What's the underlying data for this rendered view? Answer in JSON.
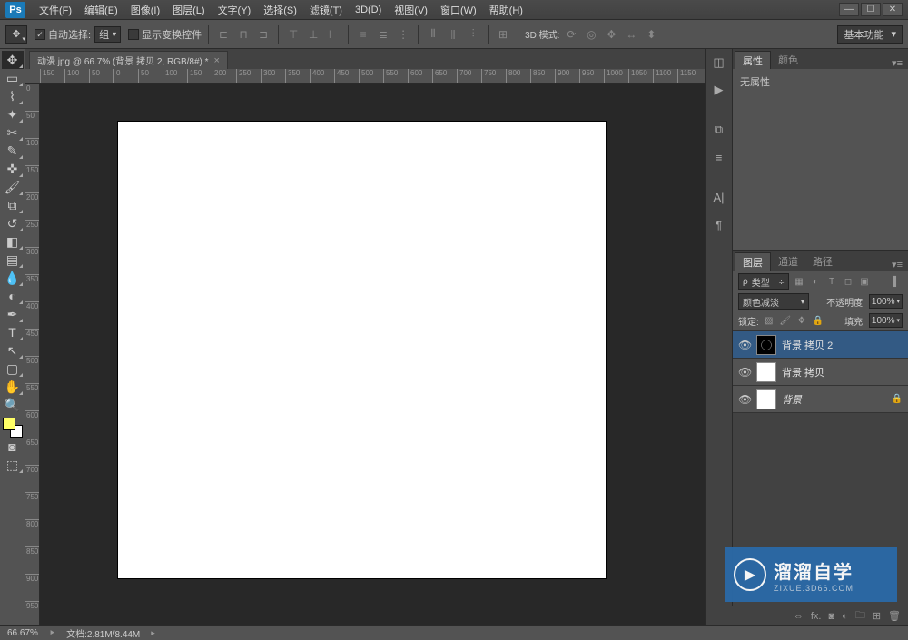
{
  "app": {
    "logo": "Ps"
  },
  "menu": {
    "file": "文件(F)",
    "edit": "编辑(E)",
    "image": "图像(I)",
    "layer": "图层(L)",
    "type": "文字(Y)",
    "select": "选择(S)",
    "filter": "滤镜(T)",
    "3d": "3D(D)",
    "view": "视图(V)",
    "window": "窗口(W)",
    "help": "帮助(H)"
  },
  "options": {
    "auto_select": "自动选择:",
    "group": "组",
    "show_transform": "显示变换控件",
    "mode_3d": "3D 模式:",
    "workspace": "基本功能"
  },
  "doc": {
    "tab_title": "动漫.jpg @ 66.7% (背景 拷贝 2, RGB/8#) *",
    "ruler_h": [
      "150",
      "100",
      "50",
      "0",
      "50",
      "100",
      "150",
      "200",
      "250",
      "300",
      "350",
      "400",
      "450",
      "500",
      "550",
      "600",
      "650",
      "700",
      "750",
      "800",
      "850",
      "900",
      "950",
      "1000",
      "1050",
      "1100",
      "1150"
    ],
    "ruler_v": [
      "0",
      "50",
      "100",
      "150",
      "200",
      "250",
      "300",
      "350",
      "400",
      "450",
      "500",
      "550",
      "600",
      "650",
      "700",
      "750",
      "800",
      "850",
      "900",
      "950"
    ]
  },
  "props": {
    "tab_props": "属性",
    "tab_color": "颜色",
    "no_props": "无属性"
  },
  "layers": {
    "tab_layers": "图层",
    "tab_channels": "通道",
    "tab_paths": "路径",
    "kind": "类型",
    "blend": "颜色减淡",
    "opacity_label": "不透明度:",
    "opacity_val": "100%",
    "lock_label": "锁定:",
    "fill_label": "填充:",
    "fill_val": "100%",
    "items": [
      {
        "name": "背景 拷贝 2",
        "selected": true,
        "thumb": "dark",
        "locked": false
      },
      {
        "name": "背景 拷贝",
        "selected": false,
        "thumb": "light",
        "locked": false
      },
      {
        "name": "背景",
        "selected": false,
        "thumb": "light",
        "locked": true,
        "italic": true
      }
    ]
  },
  "watermark": {
    "title": "溜溜自学",
    "url": "ZIXUE.3D66.COM"
  },
  "status": {
    "zoom": "66.67%",
    "docinfo": "文档:2.81M/8.44M"
  }
}
